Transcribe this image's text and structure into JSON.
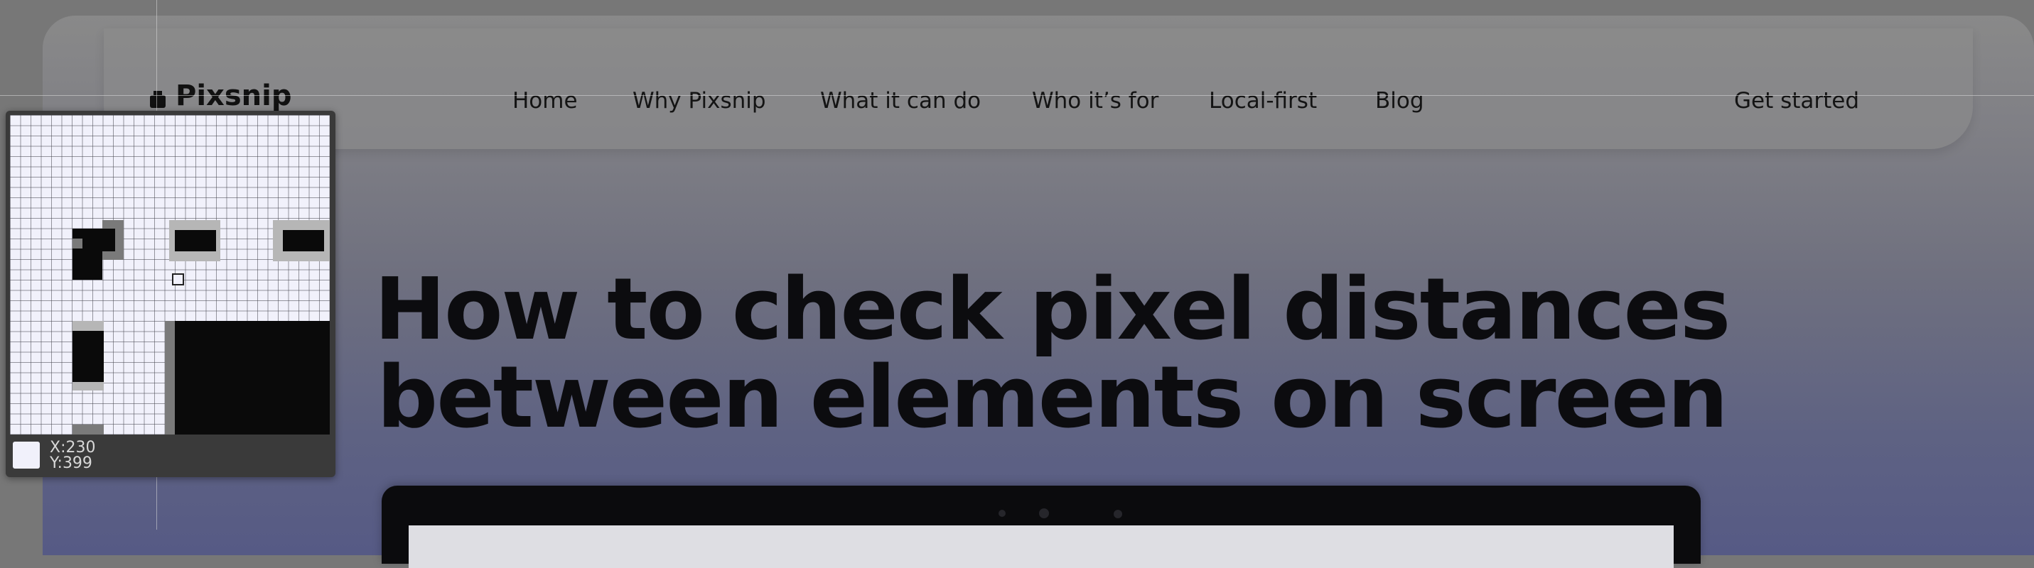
{
  "brand": {
    "name": "Pixsnip"
  },
  "nav": {
    "links": [
      "Home",
      "Why Pixsnip",
      "What it can do",
      "Who it’s for",
      "Local-first",
      "Blog"
    ],
    "cta": "Get started"
  },
  "hero": {
    "line1": "How to check pixel distances",
    "line2": "between elements on screen"
  },
  "magnifier": {
    "x_label": "X:",
    "x_value": "230",
    "y_label": "Y:",
    "y_value": "399",
    "color": "#f1f1fb"
  },
  "colors": {
    "page_bg": "#777777",
    "text": "#0c0c0f",
    "gradient_bottom": "#565a85"
  }
}
